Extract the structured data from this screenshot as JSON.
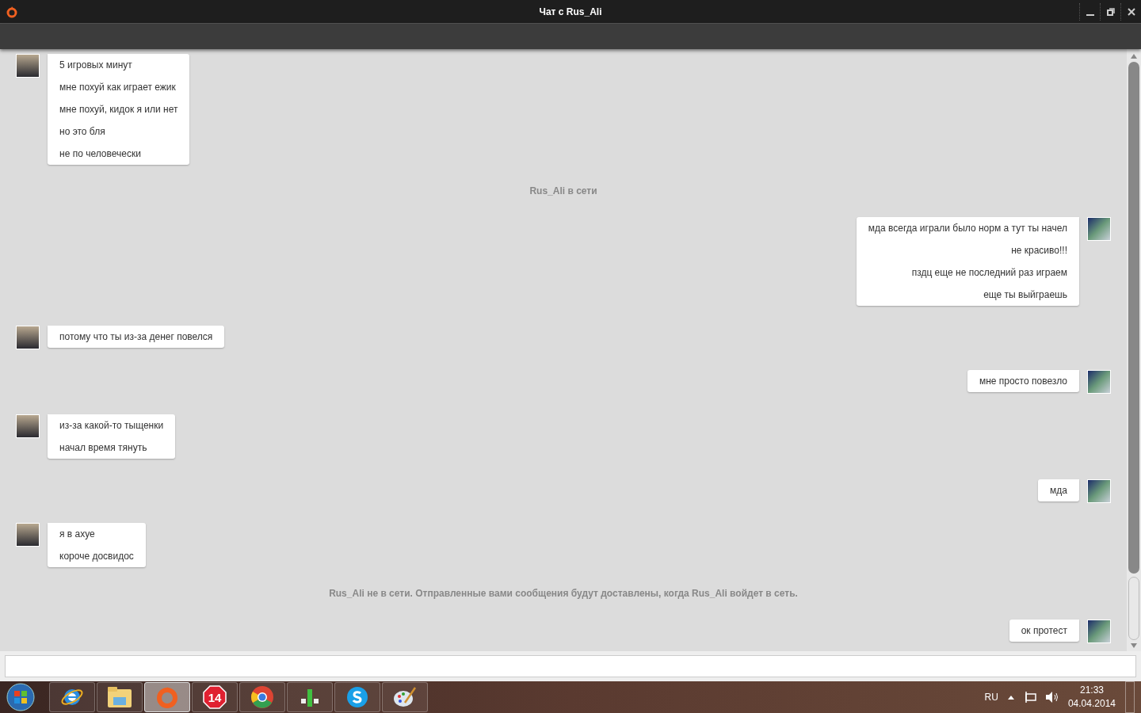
{
  "window": {
    "title": "Чат с Rus_Ali"
  },
  "messages": [
    {
      "kind": "message",
      "outgoing": false,
      "lines": [
        "5 игровых минут",
        "мне похуй как играет ежик",
        "мне похуй, кидок я или нет",
        "но это бля",
        "не по человечески"
      ]
    },
    {
      "kind": "status",
      "text": "Rus_Ali в сети"
    },
    {
      "kind": "message",
      "outgoing": true,
      "lines": [
        "мда всегда играли было норм а тут ты начел",
        "не красиво!!!",
        "пздц еще не последний раз играем",
        "еще ты выйграешь"
      ]
    },
    {
      "kind": "message",
      "outgoing": false,
      "lines": [
        "потому что ты из-за денег повелся"
      ]
    },
    {
      "kind": "message",
      "outgoing": true,
      "lines": [
        "мне просто повезло"
      ]
    },
    {
      "kind": "message",
      "outgoing": false,
      "lines": [
        "из-за какой-то тыщенки",
        "начал время тянуть"
      ]
    },
    {
      "kind": "message",
      "outgoing": true,
      "lines": [
        "мда"
      ]
    },
    {
      "kind": "message",
      "outgoing": false,
      "lines": [
        "я в ахуе",
        "короче досвидос"
      ]
    },
    {
      "kind": "status",
      "text": "Rus_Ali не в сети. Отправленные вами сообщения будут доставлены, когда Rus_Ali войдет в сеть."
    },
    {
      "kind": "message",
      "outgoing": true,
      "lines": [
        "ок протест"
      ]
    }
  ],
  "taskbar": {
    "apps": [
      {
        "kind": "ie",
        "selected": false
      },
      {
        "kind": "folder",
        "selected": false
      },
      {
        "kind": "origin",
        "selected": true
      },
      {
        "kind": "badge",
        "selected": false,
        "label": "14"
      },
      {
        "kind": "chrome",
        "selected": false
      },
      {
        "kind": "meter",
        "selected": false
      },
      {
        "kind": "skype",
        "selected": false
      },
      {
        "kind": "paint",
        "selected": false
      }
    ],
    "language": "RU",
    "time": "21:33",
    "date": "04.04.2014"
  }
}
